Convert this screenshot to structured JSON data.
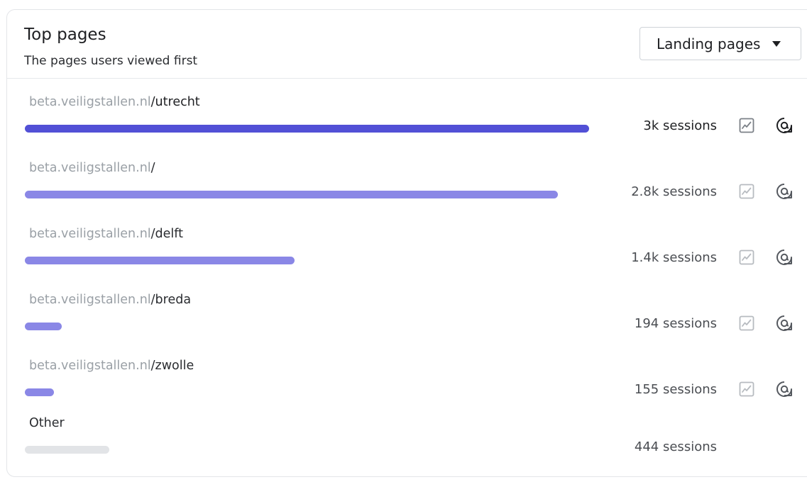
{
  "header": {
    "title": "Top pages",
    "subtitle": "The pages users viewed first"
  },
  "dropdown": {
    "selected": "Landing pages"
  },
  "rows": [
    {
      "host": "beta.veiligstallen.nl",
      "path": "/utrecht",
      "sessions": "3k sessions",
      "fraction": 1.0,
      "highlighted": true
    },
    {
      "host": "beta.veiligstallen.nl",
      "path": "/",
      "sessions": "2.8k sessions",
      "fraction": 0.945,
      "highlighted": false
    },
    {
      "host": "beta.veiligstallen.nl",
      "path": "/delft",
      "sessions": "1.4k sessions",
      "fraction": 0.478,
      "highlighted": false
    },
    {
      "host": "beta.veiligstallen.nl",
      "path": "/breda",
      "sessions": "194 sessions",
      "fraction": 0.065,
      "highlighted": false
    },
    {
      "host": "beta.veiligstallen.nl",
      "path": "/zwolle",
      "sessions": "155 sessions",
      "fraction": 0.052,
      "highlighted": false
    }
  ],
  "other": {
    "label": "Other",
    "sessions": "444 sessions",
    "fraction": 0.15
  },
  "colors": {
    "bar_primary": "#5250d6",
    "bar_secondary": "#8a87e6",
    "bar_other": "#e2e4e7"
  },
  "icons": {
    "trend": "trend-chart-icon",
    "mention": "at-sign-icon"
  }
}
